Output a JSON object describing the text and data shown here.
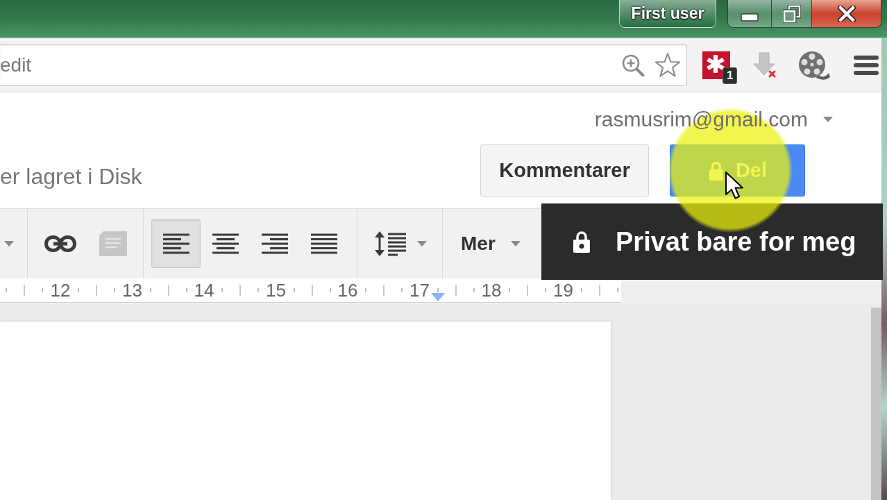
{
  "title_bar": {
    "profile": "First user"
  },
  "address_bar": {
    "url": "edit"
  },
  "extensions": [
    {
      "kind": "password",
      "badge": "1"
    },
    {
      "kind": "download"
    },
    {
      "kind": "film"
    }
  ],
  "account": {
    "email": "rasmusrim@gmail.com"
  },
  "save_status": "er lagret i Disk",
  "header_buttons": [
    {
      "kind": "comments",
      "label": "Kommentarer"
    },
    {
      "kind": "share",
      "label": "Del"
    }
  ],
  "toolbar": {
    "insert": [
      {
        "kind": "link",
        "disabled": false
      },
      {
        "kind": "comment",
        "disabled": true
      }
    ],
    "alignment": [
      {
        "kind": "left",
        "selected": true
      },
      {
        "kind": "center",
        "selected": false
      },
      {
        "kind": "right",
        "selected": false
      },
      {
        "kind": "justify",
        "selected": false
      }
    ],
    "more": "Mer"
  },
  "tooltip": {
    "text": "Privat bare for meg"
  },
  "ruler": {
    "labels": [
      "12",
      "13",
      "14",
      "15",
      "16",
      "17",
      "18",
      "19"
    ]
  }
}
